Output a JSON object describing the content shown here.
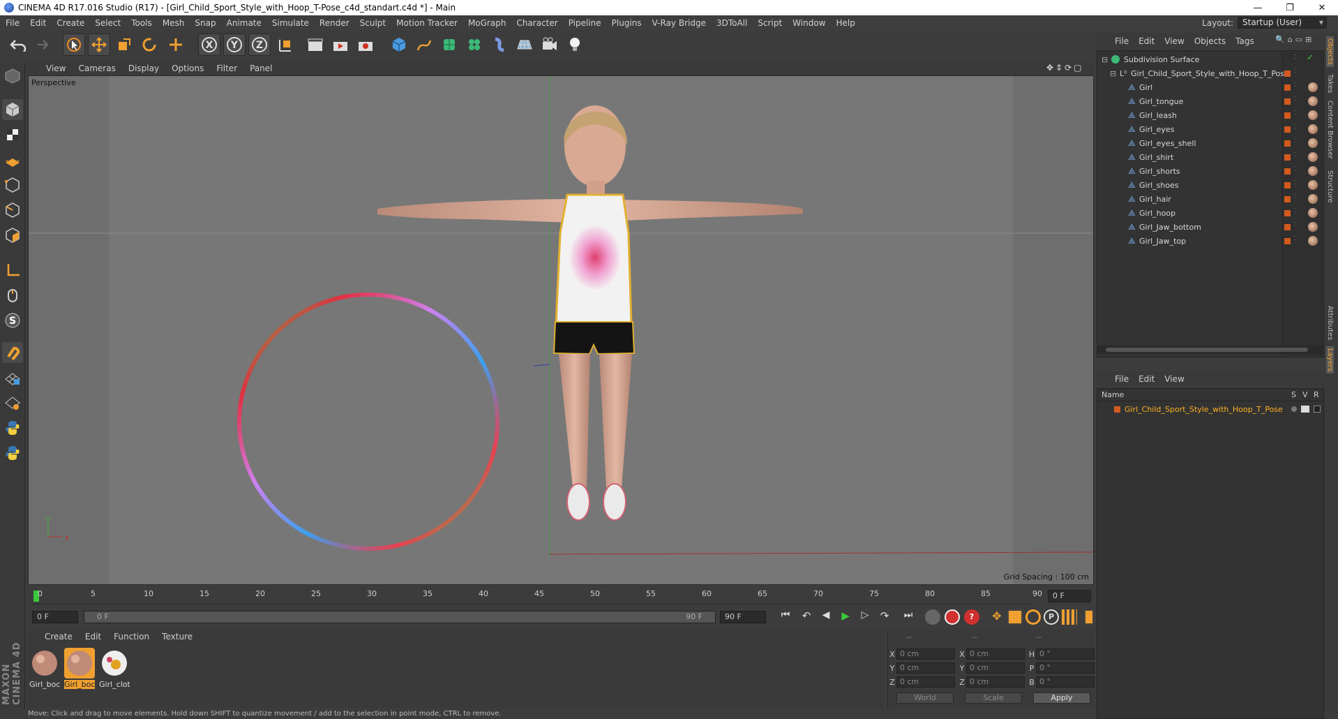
{
  "window": {
    "title": "CINEMA 4D R17.016 Studio (R17) - [Girl_Child_Sport_Style_with_Hoop_T-Pose_c4d_standart.c4d *] - Main",
    "controls": [
      "—",
      "❐",
      "✕"
    ]
  },
  "menubar": {
    "items": [
      "File",
      "Edit",
      "Create",
      "Select",
      "Tools",
      "Mesh",
      "Snap",
      "Animate",
      "Simulate",
      "Render",
      "Sculpt",
      "Motion Tracker",
      "MoGraph",
      "Character",
      "Pipeline",
      "Plugins",
      "V-Ray Bridge",
      "3DToAll",
      "Script",
      "Window",
      "Help"
    ],
    "layout_label": "Layout:",
    "layout_value": "Startup (User)"
  },
  "viewport": {
    "menu": [
      "View",
      "Cameras",
      "Display",
      "Options",
      "Filter",
      "Panel"
    ],
    "label": "Perspective",
    "grid_spacing": "Grid Spacing : 100 cm",
    "axis_y": "y",
    "axis_x": "x"
  },
  "timeline": {
    "ticks": [
      "0",
      "5",
      "10",
      "15",
      "20",
      "25",
      "30",
      "35",
      "40",
      "45",
      "50",
      "55",
      "60",
      "65",
      "70",
      "75",
      "80",
      "85",
      "90"
    ],
    "current_frame": "0 F",
    "start": "0 F",
    "range_start": "0 F",
    "range_end": "90 F",
    "end": "90 F"
  },
  "materials": {
    "menu": [
      "Create",
      "Edit",
      "Function",
      "Texture"
    ],
    "items": [
      {
        "name": "Girl_boc",
        "selected": false
      },
      {
        "name": "Girl_boc",
        "selected": true
      },
      {
        "name": "Girl_clot",
        "selected": false
      }
    ]
  },
  "coords": {
    "header": [
      "--",
      "--",
      "--"
    ],
    "rows": [
      {
        "a": "X",
        "av": "0 cm",
        "b": "X",
        "bv": "0 cm",
        "c": "H",
        "cv": "0 °"
      },
      {
        "a": "Y",
        "av": "0 cm",
        "b": "Y",
        "bv": "0 cm",
        "c": "P",
        "cv": "0 °"
      },
      {
        "a": "Z",
        "av": "0 cm",
        "b": "Z",
        "bv": "0 cm",
        "c": "B",
        "cv": "0 °"
      }
    ],
    "world": "World",
    "scale": "Scale",
    "apply": "Apply"
  },
  "objects": {
    "menu": [
      "File",
      "Edit",
      "View",
      "Objects",
      "Tags"
    ],
    "root": "Subdivision Surface",
    "group": "Girl_Child_Sport_Style_with_Hoop_T_Pose",
    "children": [
      "Girl",
      "Girl_tongue",
      "Girl_leash",
      "Girl_eyes",
      "Girl_eyes_shell",
      "Girl_shirt",
      "Girl_shorts",
      "Girl_shoes",
      "Girl_hair",
      "Girl_hoop",
      "Girl_Jaw_bottom",
      "Girl_Jaw_top"
    ]
  },
  "layers": {
    "menu": [
      "File",
      "Edit",
      "View"
    ],
    "col_name": "Name",
    "col_s": "S",
    "col_v": "V",
    "col_r": "R",
    "item": "Girl_Child_Sport_Style_with_Hoop_T_Pose"
  },
  "right_tabs": [
    "Objects",
    "Takes",
    "Content Browser",
    "Structure",
    "Attributes",
    "Layers"
  ],
  "brand": "MAXON CINEMA 4D",
  "status": "Move: Click and drag to move elements. Hold down SHIFT to quantize movement / add to the selection in point mode, CTRL to remove.",
  "colors": {
    "accent": "#d35a1e",
    "selected_text": "#ffb020",
    "play": "#3cc83c"
  }
}
